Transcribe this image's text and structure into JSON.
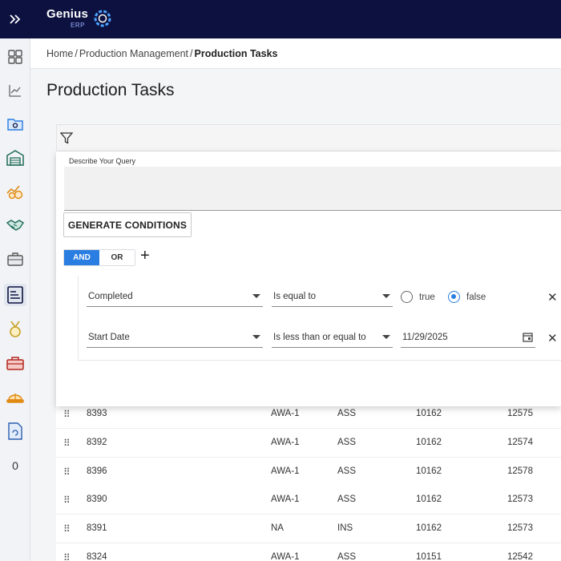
{
  "brand": {
    "name": "Genius",
    "sub": "ERP"
  },
  "icons": {
    "expand": "double-chevron-right-icon",
    "filter": "filter-funnel-icon",
    "calendar": "calendar-icon",
    "close": "close-icon",
    "add": "plus-icon",
    "drag": "drag-handle-icon"
  },
  "colors": {
    "topbar": "#0c1140",
    "accent": "#2a7de1"
  },
  "sidebar": {
    "items": [
      {
        "name": "dashboard-icon"
      },
      {
        "name": "analytics-icon"
      },
      {
        "name": "folder-settings-icon"
      },
      {
        "name": "warehouse-icon"
      },
      {
        "name": "finance-icon"
      },
      {
        "name": "handshake-icon"
      },
      {
        "name": "briefcase-icon"
      },
      {
        "name": "production-tasks-icon",
        "active": true
      },
      {
        "name": "medal-icon"
      },
      {
        "name": "toolbox-icon"
      },
      {
        "name": "hardhat-icon"
      },
      {
        "name": "document-sync-icon"
      }
    ],
    "badge": "0"
  },
  "breadcrumb": {
    "home": "Home",
    "sep": "/",
    "section": "Production Management",
    "current": "Production Tasks"
  },
  "page": {
    "title": "Production Tasks"
  },
  "filter": {
    "query_label": "Describe Your Query",
    "query_value": "",
    "generate_label": "GENERATE CONDITIONS",
    "logic": {
      "and": "AND",
      "or": "OR",
      "selected": "AND"
    },
    "add_symbol": "+",
    "conditions": [
      {
        "field": "Completed",
        "operator": "Is equal to",
        "options": [
          "true",
          "false"
        ],
        "selected": "false"
      },
      {
        "field": "Start Date",
        "operator": "Is less than or equal to",
        "value": "11/29/2025"
      }
    ],
    "remove_symbol": "✕"
  },
  "table": {
    "rows": [
      [
        "8393",
        "AWA-1",
        "ASS",
        "10162",
        "12575"
      ],
      [
        "8392",
        "AWA-1",
        "ASS",
        "10162",
        "12574"
      ],
      [
        "8396",
        "AWA-1",
        "ASS",
        "10162",
        "12578"
      ],
      [
        "8390",
        "AWA-1",
        "ASS",
        "10162",
        "12573"
      ],
      [
        "8391",
        "NA",
        "INS",
        "10162",
        "12573"
      ],
      [
        "8324",
        "AWA-1",
        "ASS",
        "10151",
        "12542"
      ]
    ]
  }
}
